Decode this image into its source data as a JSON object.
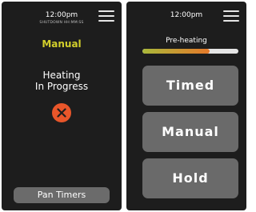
{
  "left_screen": {
    "clock": "12:00pm",
    "clock_sub": "SHUTDOWN HH:MM:SS",
    "menu_icon": "hamburger-menu-icon",
    "mode_title": "Manual",
    "status_line_1": "Heating",
    "status_line_2": "In Progress",
    "cancel_icon": "close-icon",
    "pan_timers_label": "Pan Timers"
  },
  "right_screen": {
    "clock": "12:00pm",
    "menu_icon": "hamburger-menu-icon",
    "progress_label": "Pre-heating",
    "progress_fraction": 0.7,
    "buttons": [
      "Timed",
      "Manual",
      "Hold"
    ]
  },
  "colors": {
    "accent_yellow": "#d2cf2b",
    "cancel_orange": "#e8562a",
    "progress_start": "#a9b83a",
    "progress_end": "#e5792a",
    "screen_bg": "#1d1d1d",
    "button_gray": "#6a6a6a"
  }
}
